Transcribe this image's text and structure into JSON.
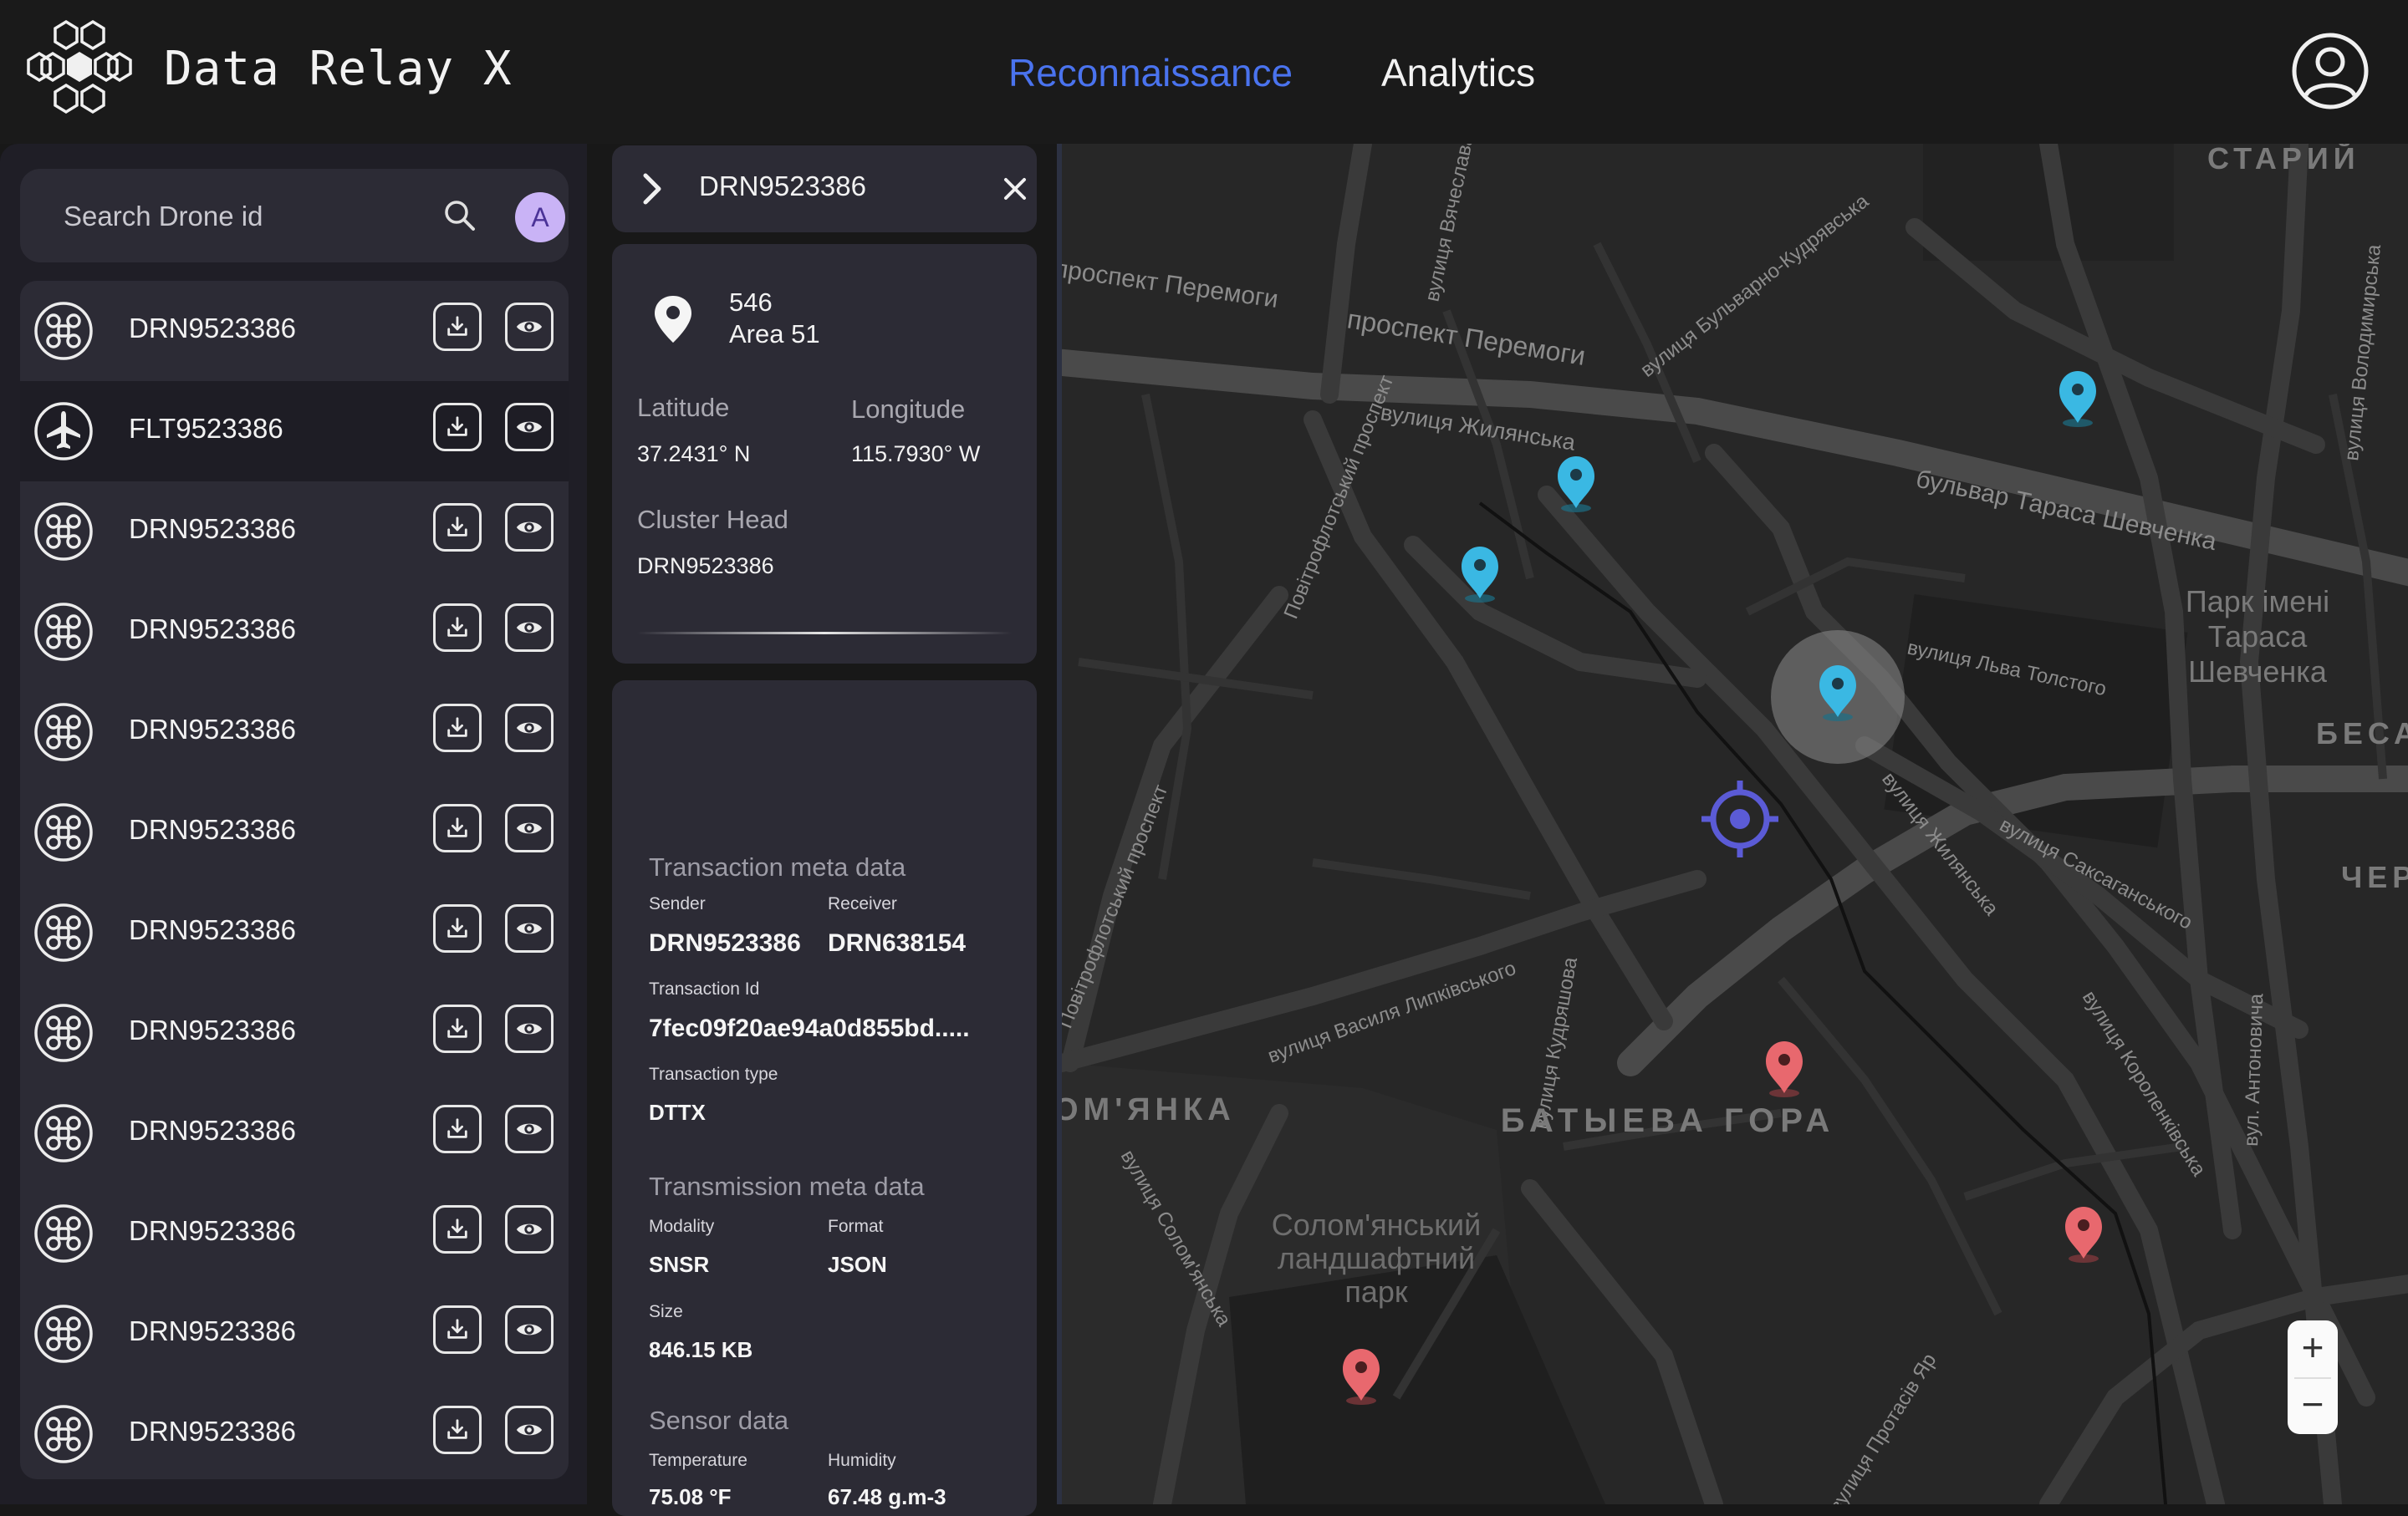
{
  "app": {
    "title": "Data Relay X"
  },
  "nav": {
    "tabs": [
      {
        "label": "Reconnaissance",
        "active": true
      },
      {
        "label": "Analytics",
        "active": false
      }
    ]
  },
  "colors": {
    "accent": "#4a73ee",
    "panel": "#2c2b35",
    "marker_blue": "#3ab8e3",
    "marker_red": "#e8686e",
    "avatar": "#c9b3f6"
  },
  "search": {
    "placeholder": "Search Drone id",
    "avatar_initial": "A"
  },
  "list": {
    "items": [
      {
        "id": "DRN9523386",
        "type": "drone-icon"
      },
      {
        "id": "FLT9523386",
        "type": "airplane-icon",
        "selected": true
      },
      {
        "id": "DRN9523386",
        "type": "drone-icon"
      },
      {
        "id": "DRN9523386",
        "type": "drone-icon"
      },
      {
        "id": "DRN9523386",
        "type": "drone-icon"
      },
      {
        "id": "DRN9523386",
        "type": "drone-icon"
      },
      {
        "id": "DRN9523386",
        "type": "drone-icon"
      },
      {
        "id": "DRN9523386",
        "type": "drone-icon"
      },
      {
        "id": "DRN9523386",
        "type": "drone-icon"
      },
      {
        "id": "DRN9523386",
        "type": "drone-icon"
      },
      {
        "id": "DRN9523386",
        "type": "drone-icon"
      },
      {
        "id": "DRN9523386",
        "type": "drone-icon"
      }
    ]
  },
  "detail": {
    "header": {
      "title": "DRN9523386"
    },
    "location": {
      "number": "546",
      "name": "Area 51",
      "latitude_label": "Latitude",
      "latitude": "37.2431° N",
      "longitude_label": "Longitude",
      "longitude": "115.7930° W",
      "cluster_head_label": "Cluster Head",
      "cluster_head": "DRN9523386"
    },
    "transaction": {
      "title": "Transaction meta data",
      "sender_label": "Sender",
      "sender": "DRN9523386",
      "receiver_label": "Receiver",
      "receiver": "DRN638154",
      "id_label": "Transaction Id",
      "id": "7fec09f20ae94a0d855bd.....",
      "type_label": "Transaction type",
      "type": "DTTX"
    },
    "transmission": {
      "title": "Transmission meta data",
      "modality_label": "Modality",
      "modality": "SNSR",
      "format_label": "Format",
      "format": "JSON",
      "size_label": "Size",
      "size": "846.15 KB"
    },
    "sensor": {
      "title": "Sensor data",
      "temperature_label": "Temperature",
      "temperature": "75.08 °F",
      "humidity_label": "Humidity",
      "humidity": "67.48 g.m-3"
    }
  },
  "map": {
    "labels": [
      "проспект Перемоги",
      "проспект Перемоги",
      "вулиця Жилянська",
      "бульвар Тараса Шевченка",
      "вулиця Бульварно-Кудрявська",
      "вулиця Вячеслава",
      "Повітрофлотський проспект",
      "Повітрофлотський проспект",
      "вулиця Льва Толстого",
      "вулиця Жилянська",
      "вулиця Саксаганського",
      "вулиця Василя Липківського",
      "вулиця Кудряшова",
      "вулиця Солом'янська",
      "вулиця Короленківська",
      "вул. Антоновича",
      "вулиця Володимирська",
      "вулиця Протасів Яр",
      "СТАРИЙ",
      "Парк імені",
      "Тараса",
      "Шевченка",
      "БЕСА",
      "ЧЕР",
      "ОМ'ЯНКА",
      "БАТЫЕВА ГОРА",
      "Солом'янський",
      "ландшафтний",
      "парк"
    ],
    "zoom_in": "+",
    "zoom_out": "−"
  }
}
